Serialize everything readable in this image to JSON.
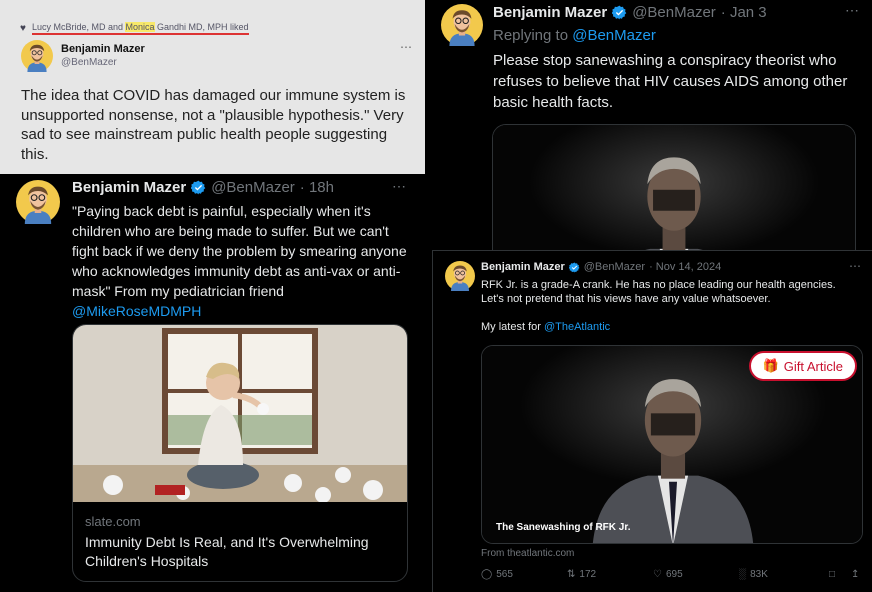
{
  "panel1": {
    "liked_prefix": "Lucy McBride, MD and ",
    "liked_highlight": "Monica",
    "liked_suffix": " Gandhi MD, MPH liked",
    "name": "Benjamin Mazer",
    "handle": "@BenMazer",
    "text": "The idea that COVID has damaged our immune system is unsupported nonsense, not a \"plausible hypothesis.\" Very sad to see mainstream public health people suggesting this."
  },
  "panel2": {
    "name": "Benjamin Mazer",
    "handle": "@BenMazer",
    "time": "· 18h",
    "text": "\"Paying back debt is painful, especially when it's children who are being made to suffer. But we can't fight back if we deny the problem by smearing anyone who acknowledges immunity debt as anti-vax or anti-mask\" From my pediatrician friend",
    "mention": "@MikeRoseMDMPH",
    "card_domain": "slate.com",
    "card_title": "Immunity Debt Is Real, and It's Overwhelming Children's Hospitals"
  },
  "panel3": {
    "name": "Benjamin Mazer",
    "handle": "@BenMazer",
    "time": "· Jan 3",
    "replying_prefix": "Replying to ",
    "replying_handle": "@BenMazer",
    "text": "Please stop sanewashing a conspiracy theorist who refuses to believe that HIV causes AIDS among other basic health facts."
  },
  "panel4": {
    "name": "Benjamin Mazer",
    "handle": "@BenMazer",
    "time": "· Nov 14, 2024",
    "text": "RFK Jr. is a grade-A crank. He has no place leading our health agencies. Let's not pretend that his views have any value whatsoever.",
    "latest_prefix": "My latest for ",
    "latest_handle": "@TheAtlantic",
    "gift_label": "Gift Article",
    "caption": "The Sanewashing of RFK Jr.",
    "from": "From theatlantic.com",
    "replies": "565",
    "reposts": "172",
    "likes": "695",
    "views": "83K"
  },
  "icons": [
    "heart-icon",
    "verified-icon",
    "more-icon",
    "gift-icon",
    "reply-icon",
    "repost-icon",
    "like-icon",
    "views-icon",
    "bookmark-icon",
    "share-icon"
  ],
  "colors": {
    "link": "#1d9bf0",
    "verified": "#1d9bf0",
    "gift_red": "#c8102e",
    "highlight": "#f8e96a",
    "underline": "#dd3333"
  }
}
